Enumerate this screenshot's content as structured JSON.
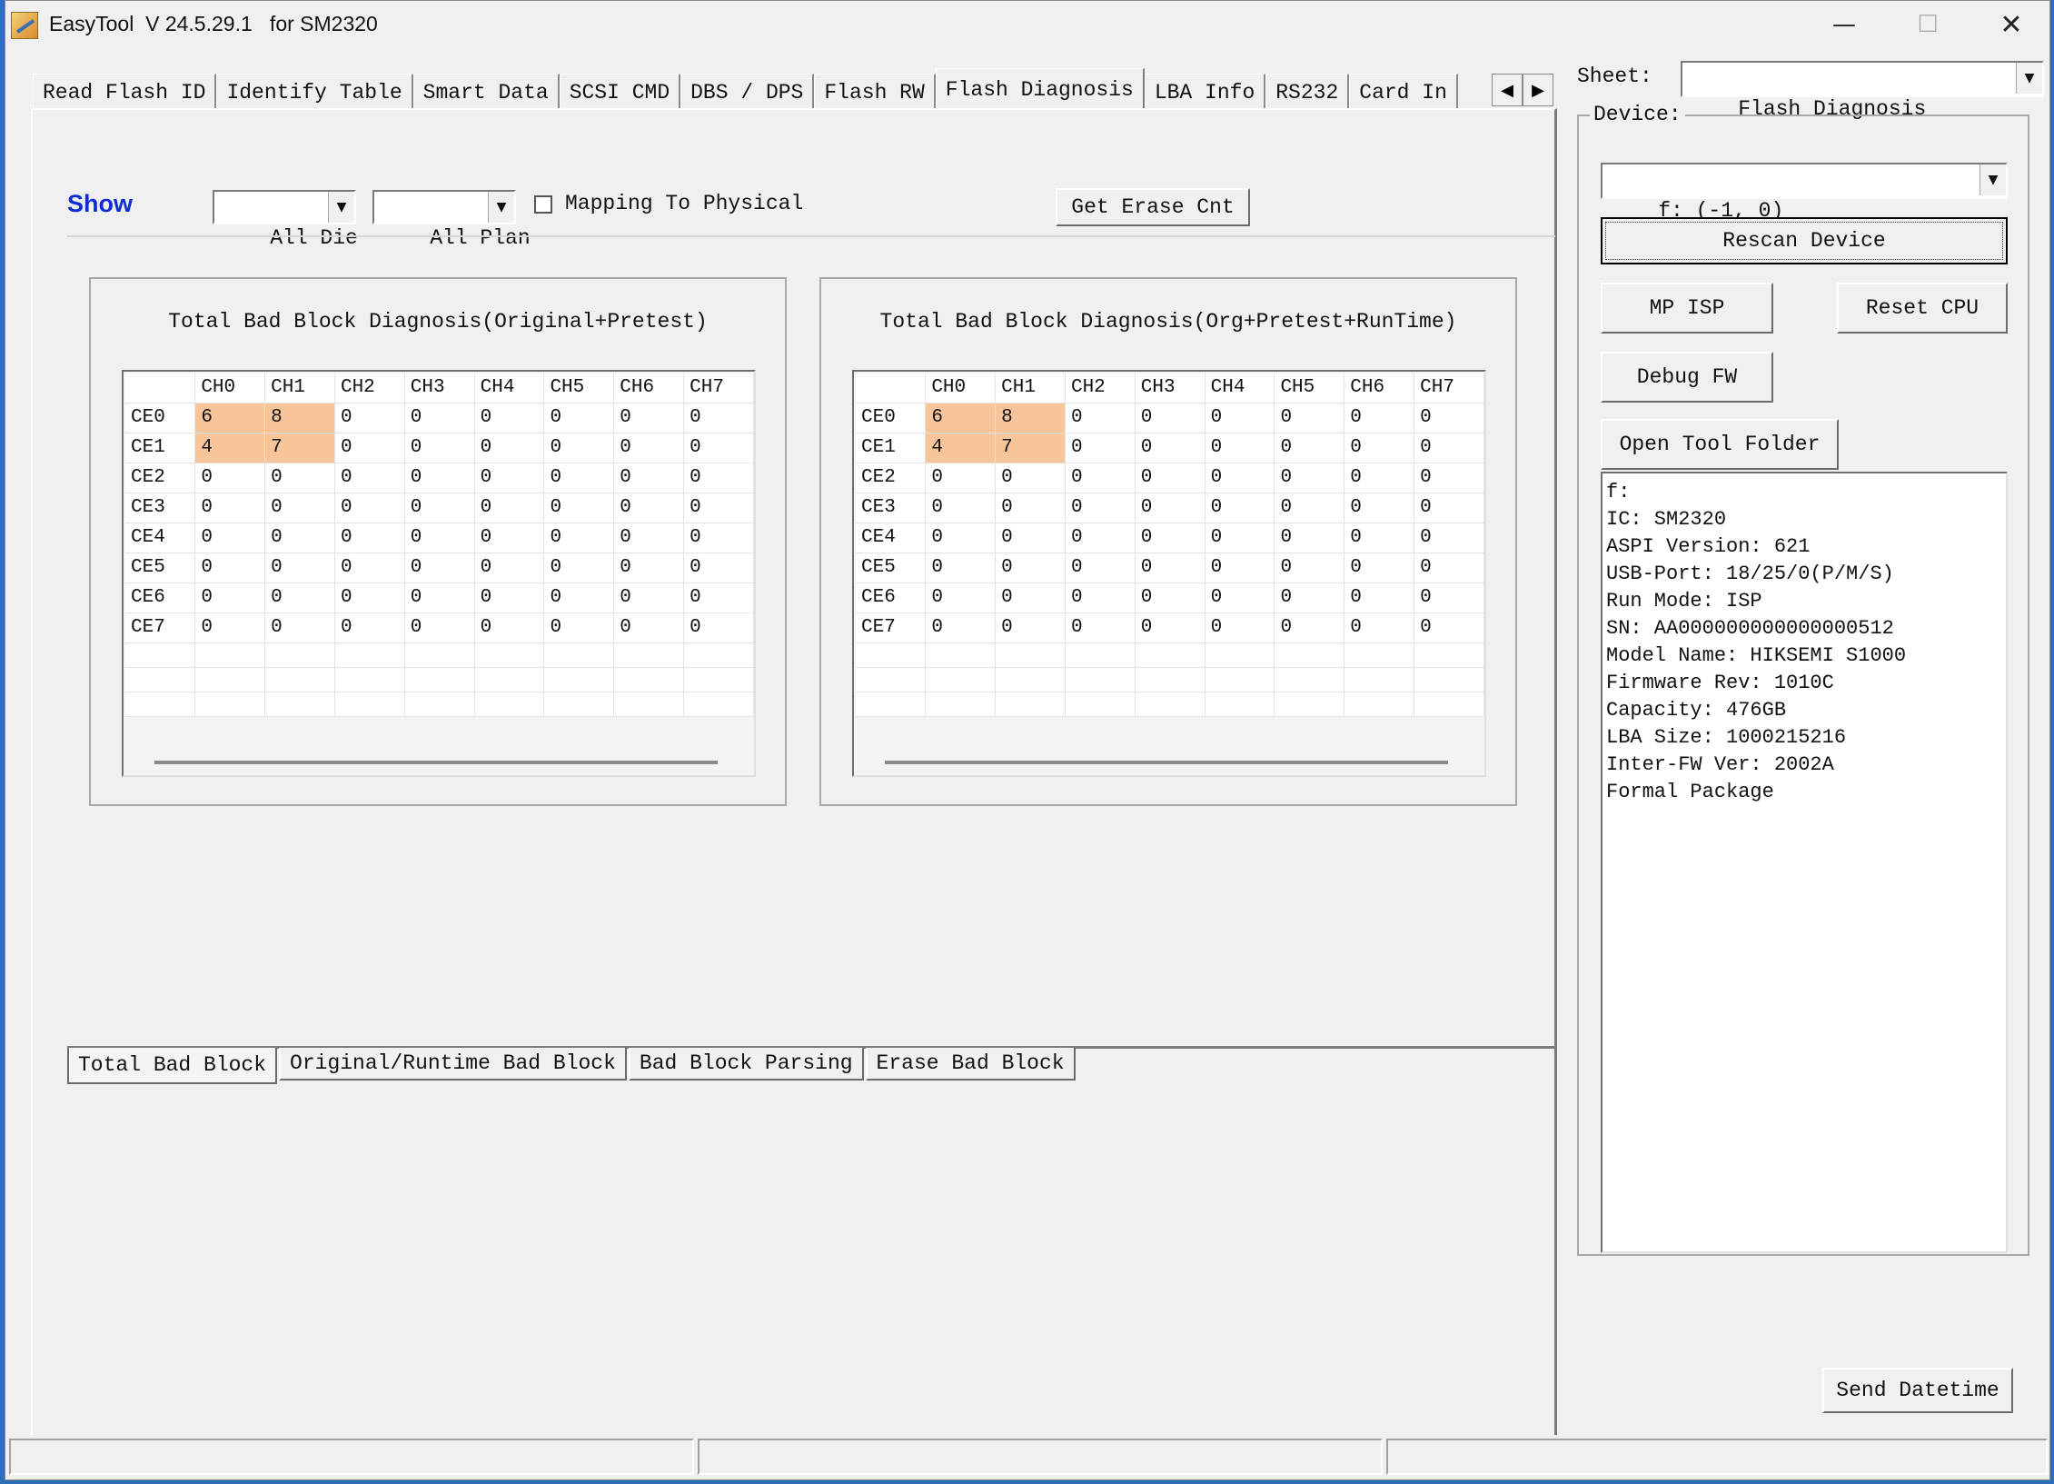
{
  "window": {
    "title": "EasyTool  V 24.5.29.1   for SM2320"
  },
  "tabs": [
    "Read Flash ID",
    "Identify Table",
    "Smart Data",
    "SCSI CMD",
    "DBS / DPS",
    "Flash RW",
    "Flash Diagnosis",
    "LBA Info",
    "RS232",
    "Card In"
  ],
  "active_tab": "Flash Diagnosis",
  "toolbar": {
    "show_label": "Show",
    "die_select": "All Die",
    "plane_select": "All Plan",
    "mapping_checkbox_label": "Mapping To Physical",
    "mapping_checked": false,
    "get_erase_cnt": "Get Erase Cnt"
  },
  "tables": [
    {
      "title": "Total Bad Block Diagnosis(Original+Pretest)",
      "columns": [
        "",
        "CH0",
        "CH1",
        "CH2",
        "CH3",
        "CH4",
        "CH5",
        "CH6",
        "CH7"
      ],
      "rows": [
        [
          "CE0",
          "6",
          "8",
          "0",
          "0",
          "0",
          "0",
          "0",
          "0"
        ],
        [
          "CE1",
          "4",
          "7",
          "0",
          "0",
          "0",
          "0",
          "0",
          "0"
        ],
        [
          "CE2",
          "0",
          "0",
          "0",
          "0",
          "0",
          "0",
          "0",
          "0"
        ],
        [
          "CE3",
          "0",
          "0",
          "0",
          "0",
          "0",
          "0",
          "0",
          "0"
        ],
        [
          "CE4",
          "0",
          "0",
          "0",
          "0",
          "0",
          "0",
          "0",
          "0"
        ],
        [
          "CE5",
          "0",
          "0",
          "0",
          "0",
          "0",
          "0",
          "0",
          "0"
        ],
        [
          "CE6",
          "0",
          "0",
          "0",
          "0",
          "0",
          "0",
          "0",
          "0"
        ],
        [
          "CE7",
          "0",
          "0",
          "0",
          "0",
          "0",
          "0",
          "0",
          "0"
        ]
      ]
    },
    {
      "title": "Total Bad Block Diagnosis(Org+Pretest+RunTime)",
      "columns": [
        "",
        "CH0",
        "CH1",
        "CH2",
        "CH3",
        "CH4",
        "CH5",
        "CH6",
        "CH7"
      ],
      "rows": [
        [
          "CE0",
          "6",
          "8",
          "0",
          "0",
          "0",
          "0",
          "0",
          "0"
        ],
        [
          "CE1",
          "4",
          "7",
          "0",
          "0",
          "0",
          "0",
          "0",
          "0"
        ],
        [
          "CE2",
          "0",
          "0",
          "0",
          "0",
          "0",
          "0",
          "0",
          "0"
        ],
        [
          "CE3",
          "0",
          "0",
          "0",
          "0",
          "0",
          "0",
          "0",
          "0"
        ],
        [
          "CE4",
          "0",
          "0",
          "0",
          "0",
          "0",
          "0",
          "0",
          "0"
        ],
        [
          "CE5",
          "0",
          "0",
          "0",
          "0",
          "0",
          "0",
          "0",
          "0"
        ],
        [
          "CE6",
          "0",
          "0",
          "0",
          "0",
          "0",
          "0",
          "0",
          "0"
        ],
        [
          "CE7",
          "0",
          "0",
          "0",
          "0",
          "0",
          "0",
          "0",
          "0"
        ]
      ]
    }
  ],
  "highlight_color": "#f8c59b",
  "bottom_tabs": [
    "Total Bad Block",
    "Original/Runtime Bad Block",
    "Bad Block Parsing",
    "Erase Bad Block"
  ],
  "active_bottom_tab": "Total Bad Block",
  "sidebar": {
    "sheet_label": "Sheet:",
    "sheet_value": "Flash Diagnosis",
    "device_label": "Device:",
    "device_value": "f: (-1, 0)",
    "rescan": "Rescan Device",
    "mp_isp": "MP ISP",
    "reset_cpu": "Reset CPU",
    "debug_fw": "Debug FW",
    "open_folder": "Open Tool Folder",
    "info": [
      "f:",
      "IC: SM2320",
      "ASPI Version: 621",
      "USB-Port: 18/25/0(P/M/S)",
      "Run Mode: ISP",
      "SN: AA000000000000000512",
      "Model Name: HIKSEMI S1000",
      "Firmware Rev: 1010C",
      "Capacity: 476GB",
      "LBA Size: 1000215216",
      "Inter-FW Ver: 2002A",
      "Formal Package"
    ],
    "send_datetime": "Send Datetime"
  }
}
